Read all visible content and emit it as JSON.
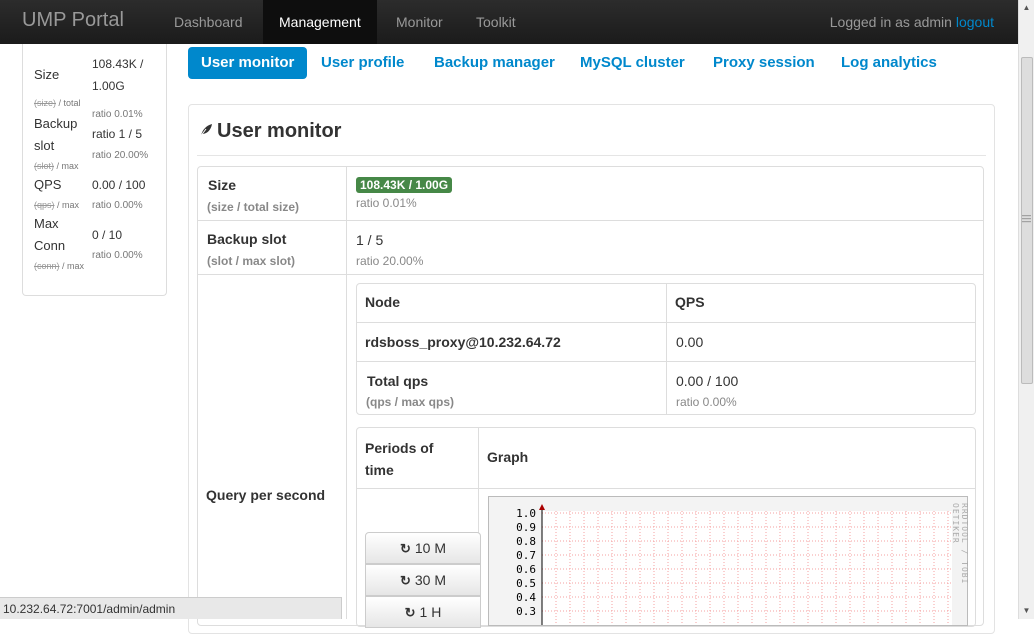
{
  "navbar": {
    "brand": "UMP Portal",
    "items": [
      "Dashboard",
      "Management",
      "Monitor",
      "Toolkit"
    ],
    "active": "Management",
    "login_text": "Logged in as admin",
    "logout_label": "logout"
  },
  "sidebar": {
    "rows": [
      {
        "label": "Size",
        "sub_strike": "(size)",
        "sub_rest": " / total",
        "value": "108.43K / 1.00G",
        "ratio": "ratio 0.01%"
      },
      {
        "label": "Backup slot",
        "sub_strike": "(slot)",
        "sub_rest": " / max",
        "value": "ratio 1 / 5",
        "ratio": "ratio 20.00%"
      },
      {
        "label": "QPS",
        "sub_strike": "(qps)",
        "sub_rest": " / max",
        "value": "0.00 / 100",
        "ratio": "ratio 0.00%"
      },
      {
        "label": "Max Conn",
        "sub_strike": "(conn)",
        "sub_rest": " / max",
        "value": "0 / 10",
        "ratio": "ratio 0.00%"
      }
    ]
  },
  "tabs": [
    "User monitor",
    "User profile",
    "Backup manager",
    "MySQL cluster",
    "Proxy session",
    "Log analytics"
  ],
  "panel": {
    "title": "User monitor",
    "size": {
      "label": "Size",
      "sub": "(size / total size)",
      "badge": "108.43K / 1.00G",
      "ratio": "ratio 0.01%"
    },
    "backup": {
      "label": "Backup slot",
      "sub": "(slot / max slot)",
      "value": "1 / 5",
      "ratio": "ratio 20.00%"
    },
    "qps_label": "Query per second",
    "node_table": {
      "headers": [
        "Node",
        "QPS"
      ],
      "node": "rdsboss_proxy@10.232.64.72",
      "node_qps": "0.00",
      "total_label": "Total qps",
      "total_sub": "(qps / max qps)",
      "total_value": "0.00 / 100",
      "total_ratio": "ratio 0.00%"
    },
    "graph_table": {
      "headers": [
        "Periods of time",
        "Graph"
      ],
      "periods": [
        "10 M",
        "30 M",
        "1 H"
      ],
      "y_ticks": [
        "1.0",
        "0.9",
        "0.8",
        "0.7",
        "0.6",
        "0.5",
        "0.4",
        "0.3"
      ],
      "watermark": "RRDTOOL / TOBI OETIKER"
    }
  },
  "status_url": "10.232.64.72:7001/admin/admin"
}
